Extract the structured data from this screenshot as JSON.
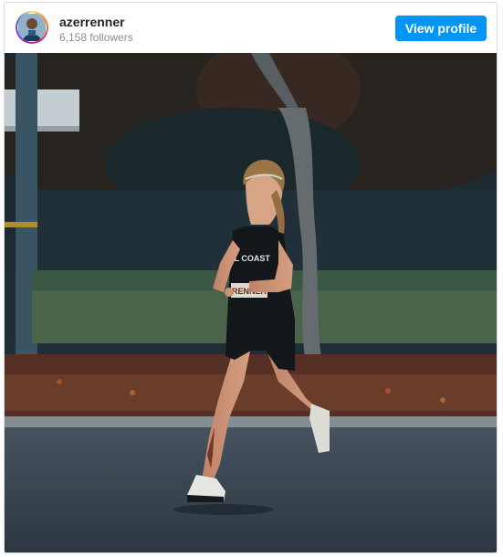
{
  "profile": {
    "username": "azerrenner",
    "followers": "6,158 followers",
    "view_profile_label": "View profile"
  },
  "post": {
    "image_subject": "runner-photo",
    "bib_text": "RENNER",
    "singlet_text": "AL COAST"
  },
  "colors": {
    "button": "#0095f6",
    "username": "#262626",
    "muted": "#8e8e8e"
  }
}
